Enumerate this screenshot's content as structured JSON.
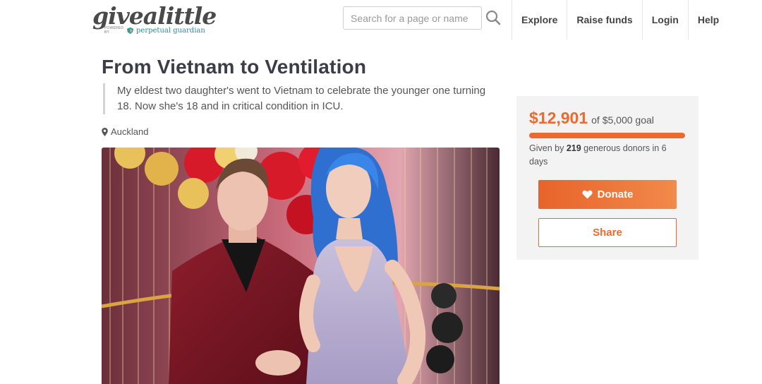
{
  "header": {
    "logo_text": "givealittle",
    "logo_powered_by": "POWERED BY",
    "logo_partner": "perpetual guardian",
    "search_placeholder": "Search for a page or name",
    "search_value": "",
    "nav": [
      "Explore",
      "Raise funds",
      "Login",
      "Help"
    ]
  },
  "page": {
    "title": "From Vietnam to Ventilation",
    "summary": "My eldest two daughter's went to Vietnam to celebrate the younger one turning 18. Now she's 18 and in critical condition in ICU.",
    "location": "Auckland"
  },
  "donation": {
    "raised": "$12,901",
    "goal_text": "of $5,000 goal",
    "progress_fraction": 1.0,
    "donors_prefix": "Given by",
    "donors_count": "219",
    "donors_suffix": "generous donors in 6 days",
    "donate_label": "Donate",
    "share_label": "Share"
  },
  "colors": {
    "accent": "#ec6a2c",
    "title": "#3d3d4a",
    "card_bg": "#f3f3f4"
  },
  "icons": {
    "search": "search-icon",
    "location": "map-pin-icon",
    "donate": "heart-icon"
  }
}
